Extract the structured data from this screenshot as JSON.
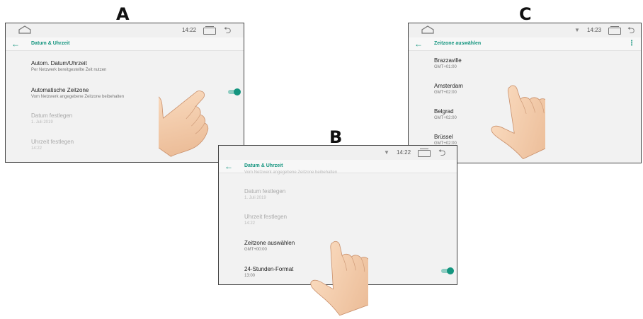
{
  "labels": {
    "a": "A",
    "b": "B",
    "c": "C"
  },
  "colors": {
    "accent": "#14957f",
    "background": "#f2f2f2",
    "text_primary": "#222222",
    "text_secondary": "#777777",
    "text_disabled": "#aaaaaa"
  },
  "screen_a": {
    "status_time": "14:22",
    "back_icon": "back-arrow-icon",
    "title": "Datum & Uhrzeit",
    "items": [
      {
        "title": "Autom. Datum/Uhrzeit",
        "summary": "Per Netzwerk bereitgestellte Zeit nutzen",
        "enabled": true
      },
      {
        "title": "Automatische Zeitzone",
        "summary": "Vom Netzwerk angegebene Zeitzone beibehalten",
        "enabled": true,
        "toggle_on": true
      },
      {
        "title": "Datum festlegen",
        "summary": "1. Juli 2019",
        "enabled": false
      },
      {
        "title": "Uhrzeit festlegen",
        "summary": "14:22",
        "enabled": false
      }
    ]
  },
  "screen_b": {
    "status_time": "14:22",
    "title": "Datum & Uhrzeit",
    "items": [
      {
        "title": "",
        "summary": "Vom Netzwerk angegebene Zeitzone beibehalten",
        "enabled": false
      },
      {
        "title": "Datum festlegen",
        "summary": "1. Juli 2019",
        "enabled": false
      },
      {
        "title": "Uhrzeit festlegen",
        "summary": "14:22",
        "enabled": false
      },
      {
        "title": "Zeitzone auswählen",
        "summary": "GMT+00:00",
        "enabled": true
      },
      {
        "title": "24-Stunden-Format",
        "summary": "13:00",
        "enabled": true,
        "toggle_on": true
      }
    ]
  },
  "screen_c": {
    "status_time": "14:23",
    "title": "Zeitzone auswählen",
    "menu_icon": "overflow-menu-icon",
    "zones": [
      {
        "name": "Brazzaville",
        "offset": "GMT+01:00"
      },
      {
        "name": "Amsterdam",
        "offset": "GMT+02:00"
      },
      {
        "name": "Belgrad",
        "offset": "GMT+02:00"
      },
      {
        "name": "Brüssel",
        "offset": "GMT+02:00"
      }
    ]
  },
  "status_icons": [
    "home-icon",
    "wifi-icon",
    "recent-apps-icon",
    "back-nav-icon"
  ]
}
